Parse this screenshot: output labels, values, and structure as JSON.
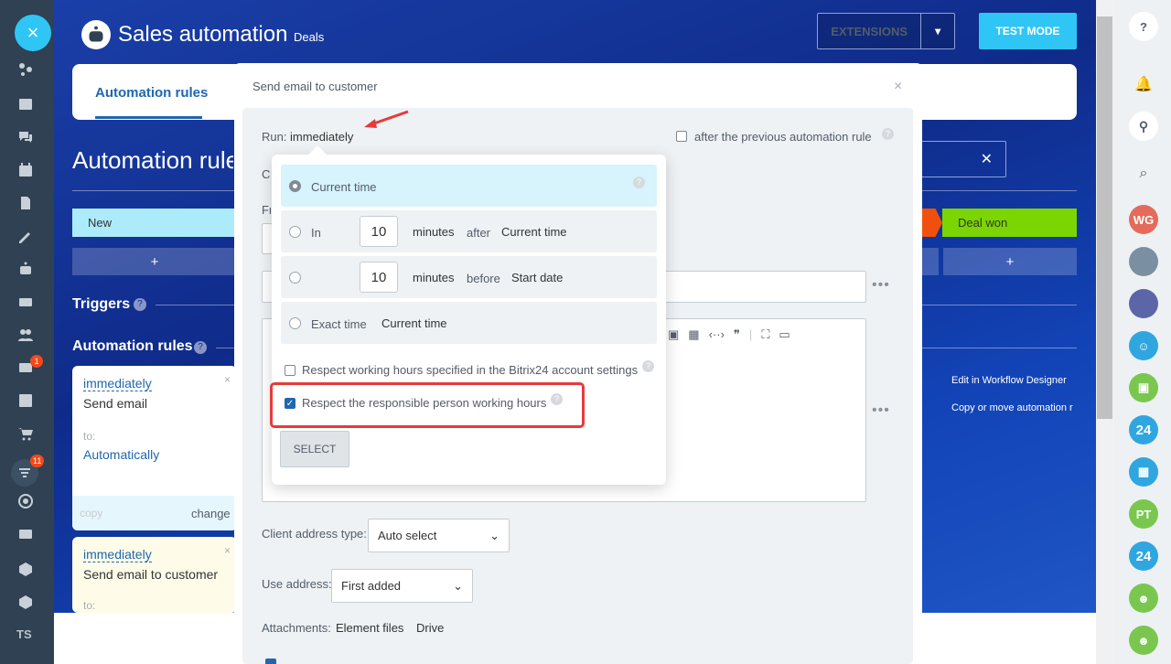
{
  "header": {
    "title": "Sales automation",
    "subtitle": "Deals",
    "extensions_label": "EXTENSIONS",
    "test_mode_label": "TEST MODE"
  },
  "tabs": {
    "active": "Automation rules"
  },
  "page": {
    "title": "Automation rules"
  },
  "stages": {
    "first": "New",
    "last": "Deal won",
    "add": "+"
  },
  "sections": {
    "triggers": "Triggers",
    "automation_rules": "Automation rules"
  },
  "cards": [
    {
      "when": "immediately",
      "action": "Send email",
      "to_label": "to:",
      "to_value": "Automatically",
      "copy": "copy",
      "change": "change"
    },
    {
      "when": "immediately",
      "action": "Send email to customer",
      "to_label": "to:"
    }
  ],
  "right_links": {
    "designer": "Edit in Workflow Designer",
    "copy_move": "Copy or move automation r"
  },
  "sidebar": {
    "badge_mail": "1",
    "badge_filter": "11",
    "user_initials": "TS"
  },
  "rightbar": {
    "avatars": [
      {
        "initials": "WG",
        "color": "#e46b5c"
      },
      {
        "initials": "PT",
        "color": "#7ac74f"
      }
    ],
    "b24": "24"
  },
  "dialog": {
    "title": "Send email to customer",
    "run_label": "Run:",
    "run_value": "immediately",
    "after_prev": "after the previous automation rule",
    "client_address_type_label": "Client address type:",
    "client_address_type_value": "Auto select",
    "use_address_label": "Use address:",
    "use_address_value": "First added",
    "attachments_label": "Attachments:",
    "attach_element": "Element files",
    "attach_drive": "Drive",
    "hidden_prefix_1": "Co",
    "hidden_prefix_2": "Fr"
  },
  "popup": {
    "opt_current": "Current time",
    "opt_in": "In",
    "opt_in_value": "10",
    "opt_in_unit": "minutes",
    "opt_in_rel": "after",
    "opt_in_base": "Current time",
    "opt_before_value": "10",
    "opt_before_unit": "minutes",
    "opt_before_rel": "before",
    "opt_before_base": "Start date",
    "opt_exact": "Exact time",
    "opt_exact_value": "Current time",
    "respect_account": "Respect working hours specified in the Bitrix24 account settings",
    "respect_responsible": "Respect the responsible person working hours",
    "select_button": "SELECT"
  }
}
